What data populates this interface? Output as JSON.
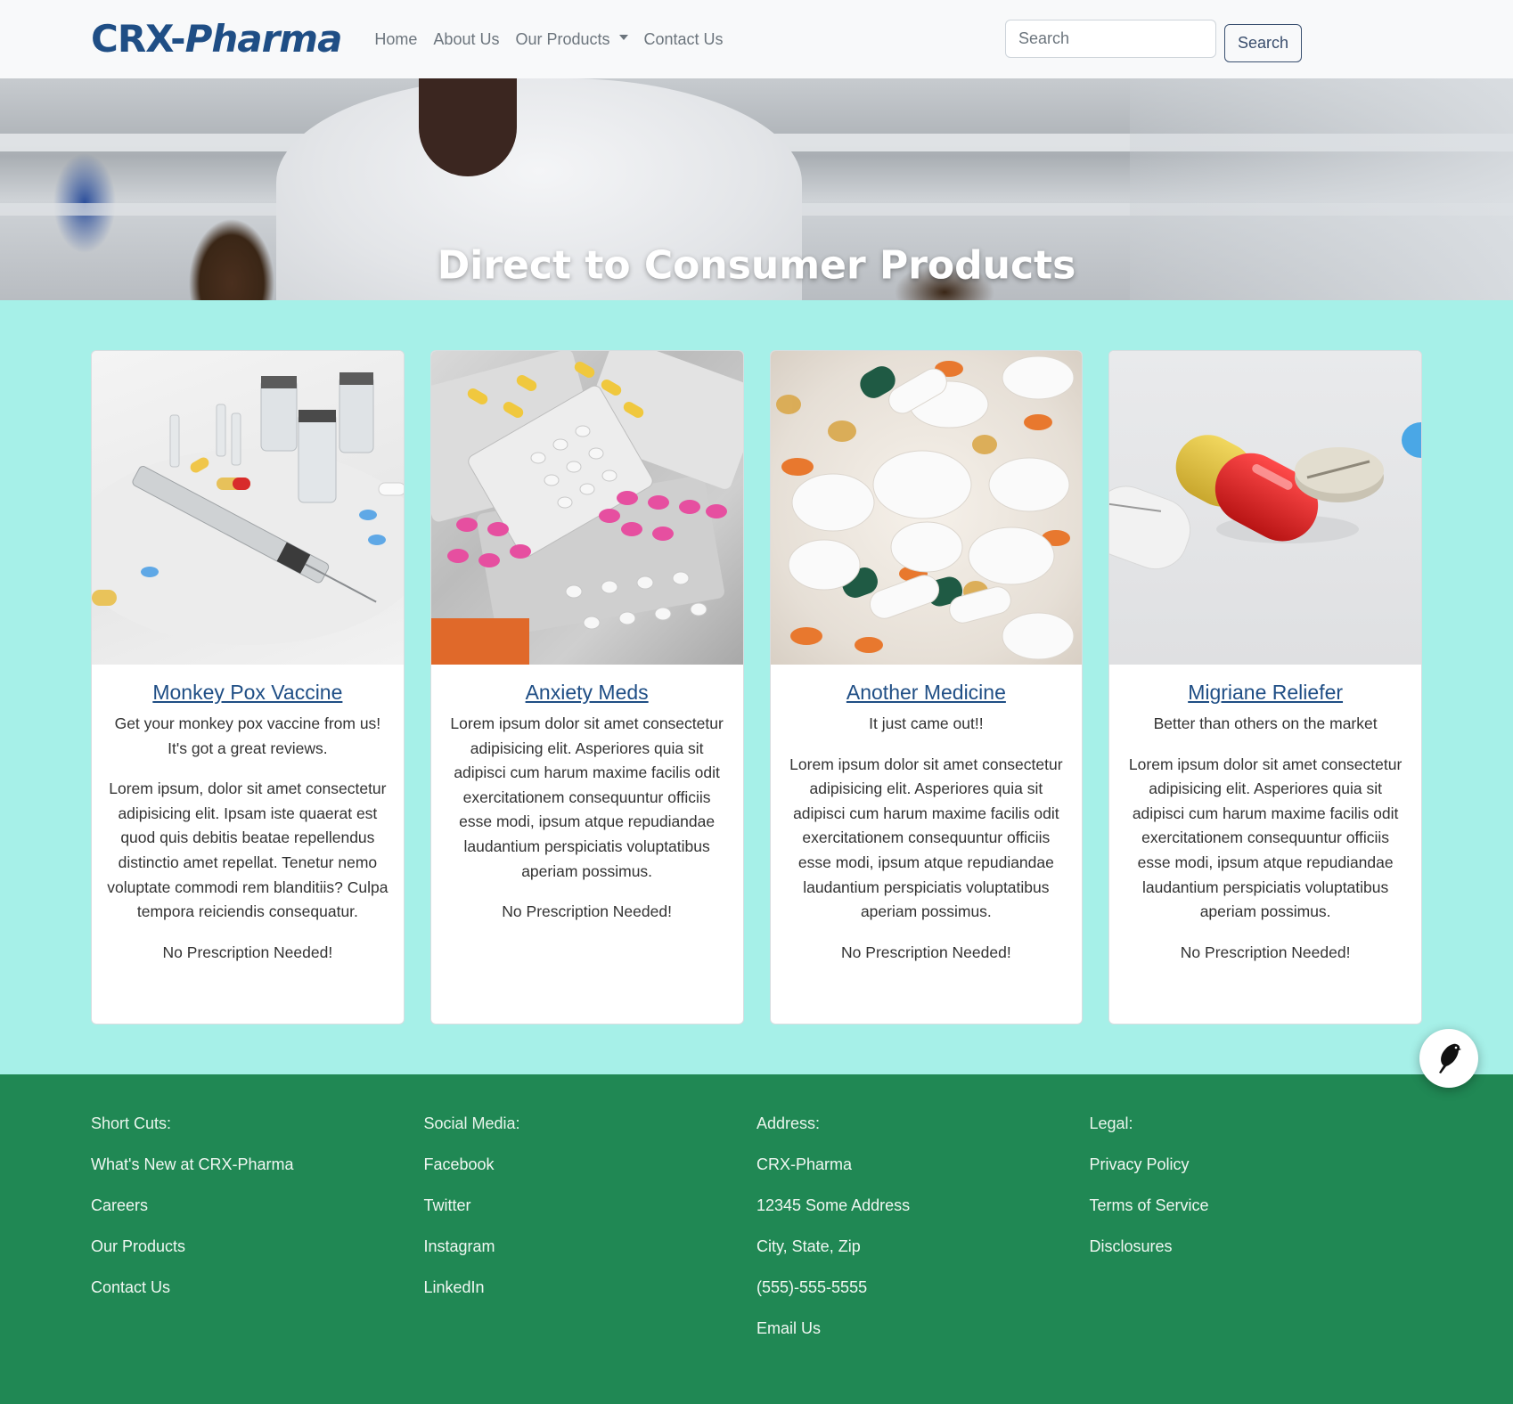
{
  "navbar": {
    "brand_part1": "CRX-",
    "brand_part2": "Pharma",
    "links": [
      {
        "label": "Home"
      },
      {
        "label": "About Us"
      },
      {
        "label": "Our Products",
        "has_dropdown": true
      },
      {
        "label": "Contact Us"
      }
    ],
    "search": {
      "placeholder": "Search",
      "value": "",
      "button_label": "Search"
    }
  },
  "hero": {
    "title": "Direct to Consumer Products"
  },
  "products": [
    {
      "title": "Monkey Pox Vaccine",
      "tagline": "Get your monkey pox vaccine from us! It's got a great reviews.",
      "description": "Lorem ipsum, dolor sit amet consectetur adipisicing elit. Ipsam iste quaerat est quod quis debitis beatae repellendus distinctio amet repellat. Tenetur nemo voluptate commodi rem blanditiis? Culpa tempora reiciendis consequatur.",
      "note": "No Prescription Needed!",
      "image": "syringe-and-vials"
    },
    {
      "title": "Anxiety Meds",
      "tagline": "",
      "description": "Lorem ipsum dolor sit amet consectetur adipisicing elit. Asperiores quia sit adipisci cum harum maxime facilis odit exercitationem consequuntur officiis esse modi, ipsum atque repudiandae laudantium perspiciatis voluptatibus aperiam possimus.",
      "note": "No Prescription Needed!",
      "image": "blister-packs"
    },
    {
      "title": "Another Medicine",
      "tagline": "It just came out!!",
      "description": "Lorem ipsum dolor sit amet consectetur adipisicing elit. Asperiores quia sit adipisci cum harum maxime facilis odit exercitationem consequuntur officiis esse modi, ipsum atque repudiandae laudantium perspiciatis voluptatibus aperiam possimus.",
      "note": "No Prescription Needed!",
      "image": "pile-of-pills"
    },
    {
      "title": "Migriane Reliefer",
      "tagline": "Better than others on the market",
      "description": "Lorem ipsum dolor sit amet consectetur adipisicing elit. Asperiores quia sit adipisci cum harum maxime facilis odit exercitationem consequuntur officiis esse modi, ipsum atque repudiandae laudantium perspiciatis voluptatibus aperiam possimus.",
      "note": "No Prescription Needed!",
      "image": "capsule-and-tablets"
    }
  ],
  "footer": {
    "columns": [
      {
        "heading": "Short Cuts:",
        "items": [
          "What's New at CRX-Pharma",
          "Careers",
          "Our Products",
          "Contact Us"
        ]
      },
      {
        "heading": "Social Media:",
        "items": [
          "Facebook",
          "Twitter",
          "Instagram",
          "LinkedIn"
        ]
      },
      {
        "heading": "Address:",
        "items": [
          "CRX-Pharma",
          "12345 Some Address",
          "City, State, Zip",
          "(555)-555-5555",
          "Email Us"
        ]
      },
      {
        "heading": "Legal:",
        "items": [
          "Privacy Policy",
          "Terms of Service",
          "Disclosures"
        ]
      }
    ]
  },
  "floating_button": {
    "icon": "bird-icon"
  },
  "colors": {
    "brand": "#1f4e85",
    "products_bg": "#a6f0e8",
    "footer_bg": "#208854",
    "navbar_bg": "#f8f9fa"
  }
}
